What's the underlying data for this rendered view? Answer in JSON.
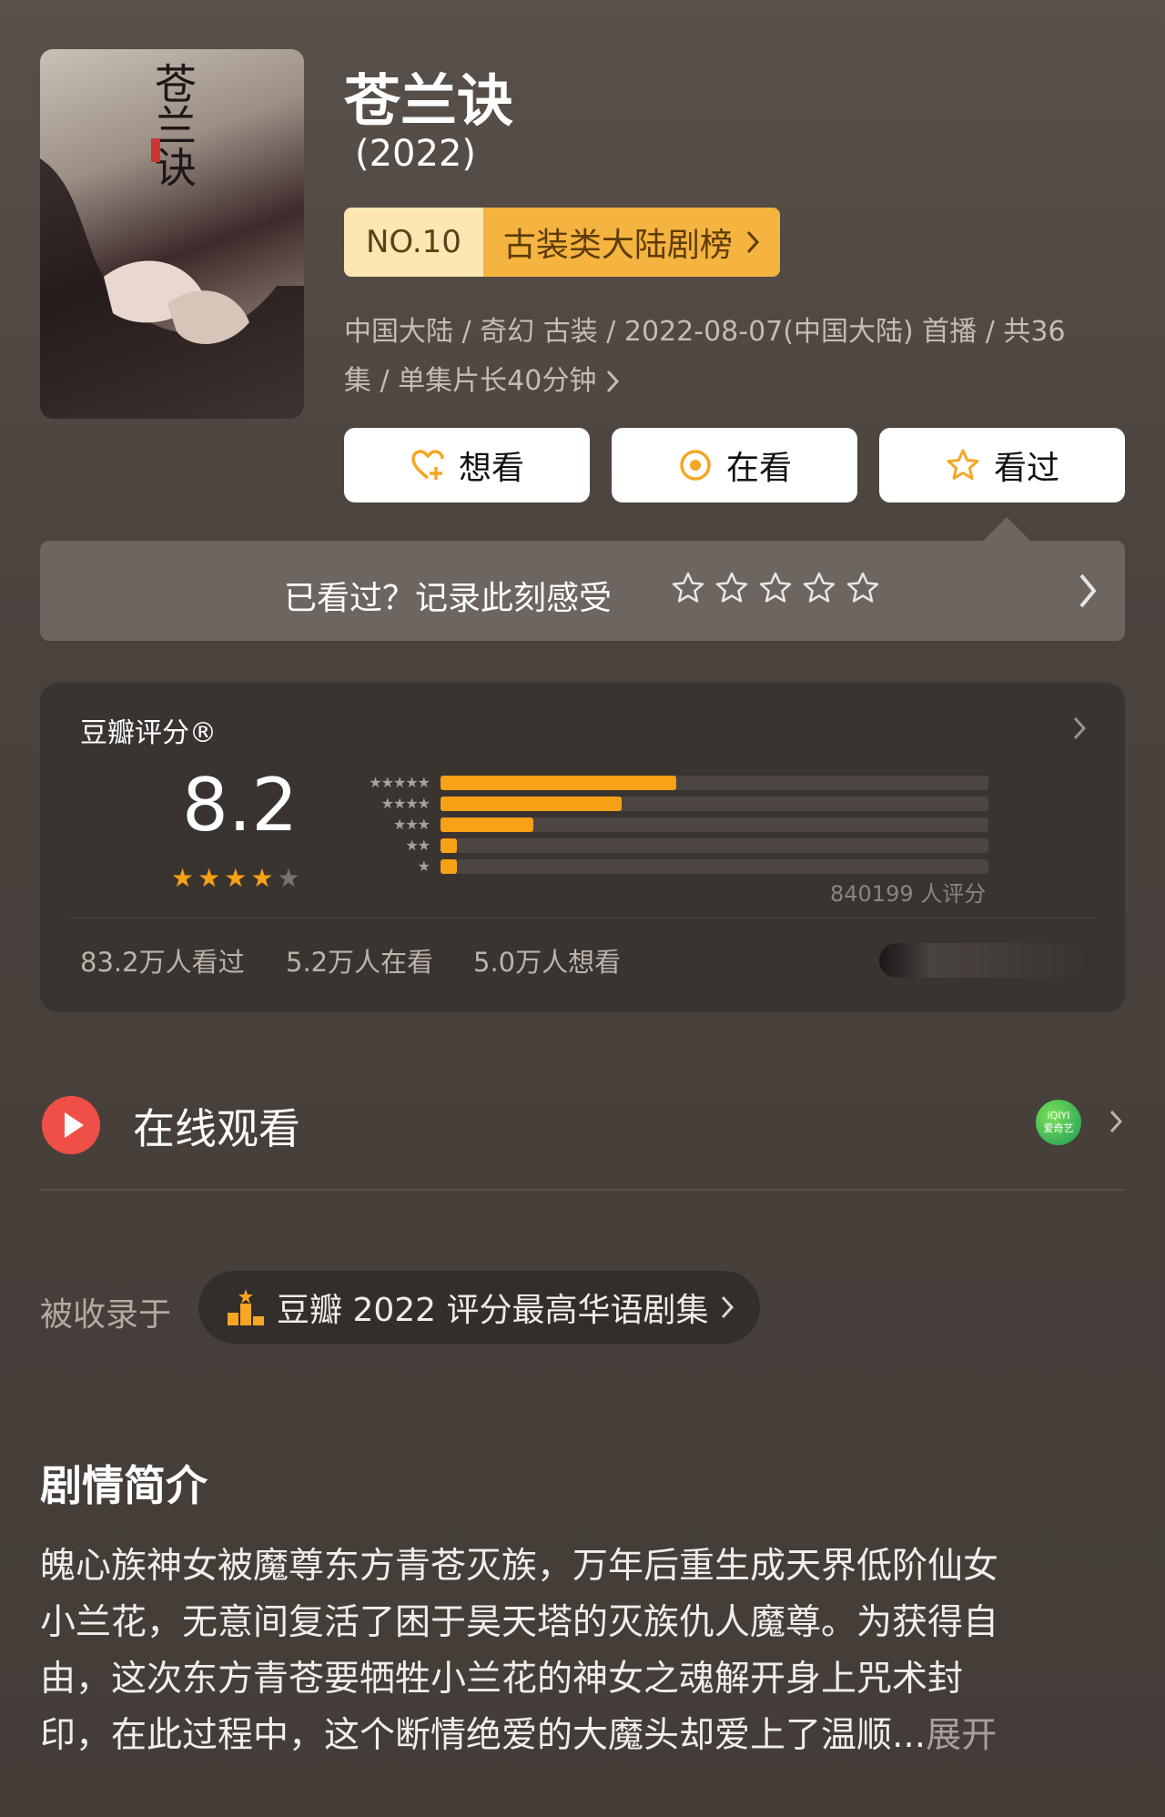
{
  "movie": {
    "title": "苍兰诀",
    "year": "(2022)",
    "poster_title": "苍兰诀"
  },
  "rank": {
    "no": "NO.10",
    "category": "古装类大陆剧榜"
  },
  "meta": {
    "line1": "中国大陆 / 奇幻 古装 / 2022-08-07(中国大陆) 首播 / 共36",
    "line2": "集 / 单集片长40分钟"
  },
  "actions": {
    "want": "想看",
    "watching": "在看",
    "watched": "看过"
  },
  "rate_prompt": {
    "text": "已看过？记录此刻感受"
  },
  "rating": {
    "header": "豆瓣评分®",
    "score": "8.2",
    "stars_filled": 4,
    "distribution": [
      0.43,
      0.33,
      0.17,
      0.03,
      0.03
    ],
    "votes": "840199 人评分",
    "watched": "83.2万人看过",
    "watching": "5.2万人在看",
    "want": "5.0万人想看"
  },
  "online": {
    "label": "在线观看",
    "platform": "iQIYI\n爱奇艺"
  },
  "included": {
    "label": "被收录于",
    "list": "豆瓣 2022 评分最高华语剧集"
  },
  "synopsis": {
    "title": "剧情简介",
    "line1": "魄心族神女被魔尊东方青苍灭族，万年后重生成天界低阶仙女",
    "line2": "小兰花，无意间复活了困于昊天塔的灭族仇人魔尊。为获得自",
    "line3": "由，这次东方青苍要牺牲小兰花的神女之魂解开身上咒术封",
    "line4": "印，在此过程中，这个断情绝爱的大魔头却爱上了温顺...",
    "more": "展开"
  },
  "colors": {
    "accent": "#f7a116",
    "rank_left": "#fde6b2",
    "rank_right": "#f5b33f",
    "play": "#f04f47"
  }
}
